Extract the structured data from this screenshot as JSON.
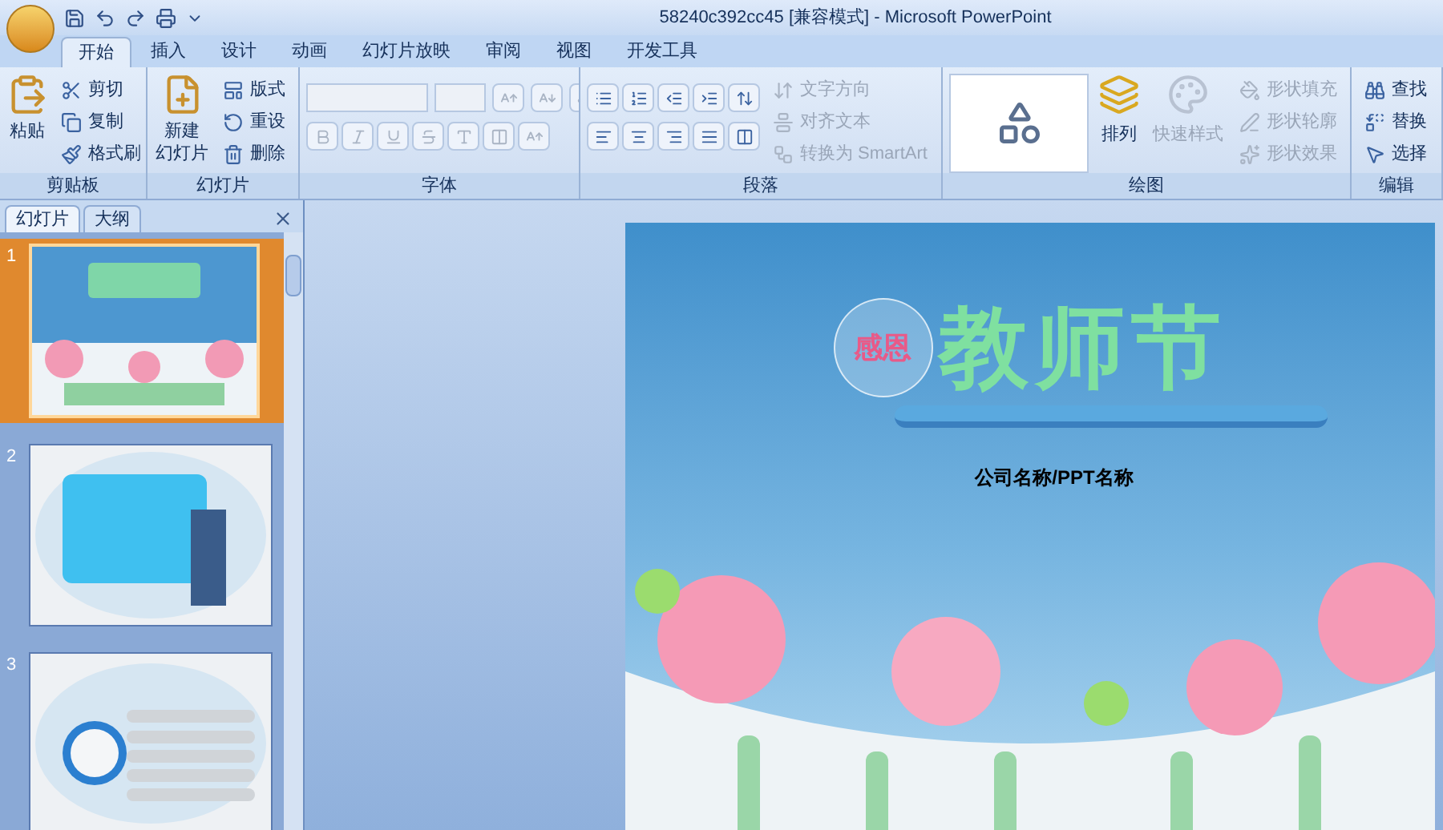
{
  "window": {
    "title": "58240c392cc45 [兼容模式] - Microsoft PowerPoint"
  },
  "tabs": [
    {
      "label": "开始",
      "selected": true
    },
    {
      "label": "插入",
      "selected": false
    },
    {
      "label": "设计",
      "selected": false
    },
    {
      "label": "动画",
      "selected": false
    },
    {
      "label": "幻灯片放映",
      "selected": false
    },
    {
      "label": "审阅",
      "selected": false
    },
    {
      "label": "视图",
      "selected": false
    },
    {
      "label": "开发工具",
      "selected": false
    }
  ],
  "ribbon": {
    "groups": [
      {
        "kind": "clipboard",
        "title": "剪贴板",
        "large": {
          "lines": [
            "粘贴"
          ],
          "disabled": false
        },
        "items": [
          {
            "label": "剪切",
            "disabled": false
          },
          {
            "label": "复制",
            "disabled": false
          },
          {
            "label": "格式刷",
            "disabled": false
          }
        ]
      },
      {
        "kind": "slides",
        "title": "幻灯片",
        "large": {
          "lines": [
            "新建",
            "幻灯片"
          ],
          "disabled": false
        },
        "items": [
          {
            "label": "版式",
            "disabled": false
          },
          {
            "label": "重设",
            "disabled": false
          },
          {
            "label": "删除",
            "disabled": false
          }
        ]
      },
      {
        "kind": "font",
        "title": "字体",
        "disabled": true
      },
      {
        "kind": "paragraph",
        "title": "段落",
        "items": [
          {
            "label": "文字方向",
            "disabled": true
          },
          {
            "label": "对齐文本",
            "disabled": true
          },
          {
            "label": "转换为 SmartArt",
            "disabled": true
          }
        ]
      },
      {
        "kind": "drawing",
        "title": "绘图",
        "large": [
          {
            "label": "排列",
            "disabled": false
          },
          {
            "label": "快速样式",
            "disabled": true
          }
        ],
        "items": [
          {
            "label": "形状填充",
            "disabled": true
          },
          {
            "label": "形状轮廓",
            "disabled": true
          },
          {
            "label": "形状效果",
            "disabled": true
          }
        ]
      },
      {
        "kind": "editing",
        "title": "编辑",
        "items": [
          {
            "label": "查找",
            "disabled": false
          },
          {
            "label": "替换",
            "disabled": false
          },
          {
            "label": "选择",
            "disabled": false
          }
        ]
      }
    ]
  },
  "pane": {
    "tabs": [
      {
        "label": "幻灯片",
        "selected": true
      },
      {
        "label": "大纲",
        "selected": false
      }
    ],
    "slides": [
      {
        "number": "1",
        "selected": true
      },
      {
        "number": "2",
        "selected": false
      },
      {
        "number": "3",
        "selected": false
      }
    ]
  },
  "slide": {
    "badge": "感恩",
    "title": "教师节",
    "subtitle": "公司名称/PPT名称"
  }
}
